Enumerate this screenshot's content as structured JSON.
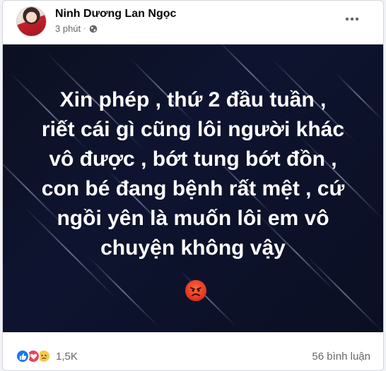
{
  "post": {
    "author": "Ninh Dương Lan Ngọc",
    "time": "3 phút",
    "separator": "·",
    "privacy_icon": "globe-icon",
    "menu_icon": "more-options-icon",
    "text_lines": [
      "Xin phép , thứ 2 đầu tuần ,",
      "riết cái gì cũng lôi người khác",
      "vô được , bớt tung bớt đồn ,",
      "con bé đang bệnh rất mệt , cứ",
      "ngồi yên là muốn lôi em vô",
      "chuyện không vậy"
    ],
    "emoji": "angry-face-emoji"
  },
  "footer": {
    "reactions": [
      "like-icon",
      "love-icon",
      "sad-icon"
    ],
    "reaction_count": "1,5K",
    "comment_count": "56 bình luận"
  },
  "colors": {
    "like": "#1877f2",
    "love": "#f33e58",
    "sad": "#f7c948",
    "background": "#0c1021"
  }
}
